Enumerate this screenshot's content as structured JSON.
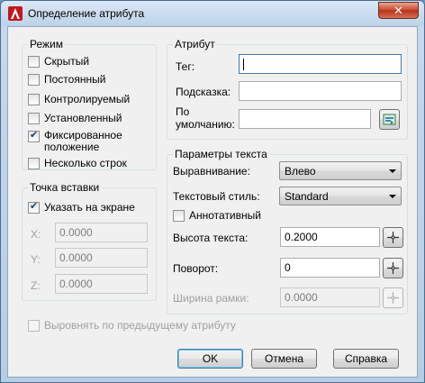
{
  "window": {
    "title": "Определение атрибута",
    "close_label": "✕"
  },
  "mode": {
    "title": "Режим",
    "items": [
      {
        "label": "Скрытый",
        "checked": false
      },
      {
        "label": "Постоянный",
        "checked": false
      },
      {
        "label": "Контролируемый",
        "checked": false
      },
      {
        "label": "Установленный",
        "checked": false
      },
      {
        "label": "Фиксированное положение",
        "checked": true
      },
      {
        "label": "Несколько строк",
        "checked": false
      }
    ]
  },
  "attribute": {
    "title": "Атрибут",
    "tag_label": "Тег:",
    "tag_value": "",
    "prompt_label": "Подсказка:",
    "prompt_value": "",
    "default_label_1": "По",
    "default_label_2": "умолчанию:",
    "default_value": ""
  },
  "insertion": {
    "title": "Точка вставки",
    "specify_label": "Указать на экране",
    "specify_checked": true,
    "x_label": "X:",
    "x_value": "0.0000",
    "y_label": "Y:",
    "y_value": "0.0000",
    "z_label": "Z:",
    "z_value": "0.0000"
  },
  "text_params": {
    "title": "Параметры текста",
    "justification_label": "Выравнивание:",
    "justification_value": "Влево",
    "style_label": "Текстовый стиль:",
    "style_value": "Standard",
    "annotative_label": "Аннотативный",
    "annotative_checked": false,
    "height_label": "Высота текста:",
    "height_value": "0.2000",
    "rotation_label": "Поворот:",
    "rotation_value": "0",
    "width_label": "Ширина рамки:",
    "width_value": "0.0000"
  },
  "align_prev_label": "Выровнять по предыдущему атрибуту",
  "buttons": {
    "ok": "OK",
    "cancel": "Отмена",
    "help": "Справка"
  }
}
